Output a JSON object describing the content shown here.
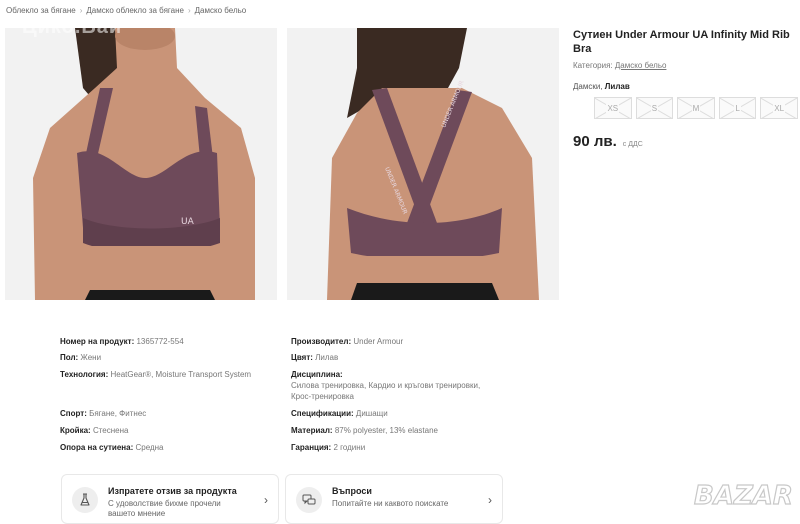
{
  "breadcrumb": {
    "items": [
      "Облекло за бягане",
      "Дамско облекло за бягане",
      "Дамско бельо"
    ]
  },
  "watermark_top": "Цико.Бай",
  "product": {
    "title": "Сутиен Under Armour UA Infinity Mid Rib Bra",
    "category_label": "Категория:",
    "category_value": "Дамско бельо",
    "variant_label": "Дамски,",
    "variant_value": "Лилав",
    "sizes": [
      "XS",
      "S",
      "M",
      "L",
      "XL"
    ],
    "price": "90 лв.",
    "vat_note": "с ДДС"
  },
  "specs_left": {
    "product_number": {
      "label": "Номер на продукт:",
      "value": "1365772-554"
    },
    "gender": {
      "label": "Пол:",
      "value": "Жени"
    },
    "technology": {
      "label": "Технология:",
      "value": "HeatGear®, Moisture Transport System"
    },
    "sport": {
      "label": "Спорт:",
      "value": "Бягане, Фитнес"
    },
    "fit": {
      "label": "Кройка:",
      "value": "Стеснена"
    },
    "support": {
      "label": "Опора на сутиена:",
      "value": "Средна"
    }
  },
  "specs_right": {
    "manufacturer": {
      "label": "Производител:",
      "value": "Under Armour"
    },
    "color": {
      "label": "Цвят:",
      "value": "Лилав"
    },
    "discipline": {
      "label": "Дисциплина:",
      "value": "Силова тренировка, Кардио и кръгови тренировки, Крос-тренировка"
    },
    "specification": {
      "label": "Спецификации:",
      "value": "Дишащи"
    },
    "material": {
      "label": "Материал:",
      "value": "87% polyester, 13% elastane"
    },
    "warranty": {
      "label": "Гаранция:",
      "value": "2 години"
    }
  },
  "cards": {
    "review": {
      "title": "Изпратете отзив за продукта",
      "subtitle": "С удоволствие бихме прочели вашето мнение",
      "icon": "flask-icon"
    },
    "questions": {
      "title": "Въпроси",
      "subtitle": "Попитайте ни каквото поискате",
      "icon": "chat-bubbles-icon"
    }
  },
  "logo": {
    "text": "BAZAR"
  },
  "colors": {
    "bra": "#6e4a5a",
    "skin": "#c99478",
    "hair": "#3a2a22"
  }
}
